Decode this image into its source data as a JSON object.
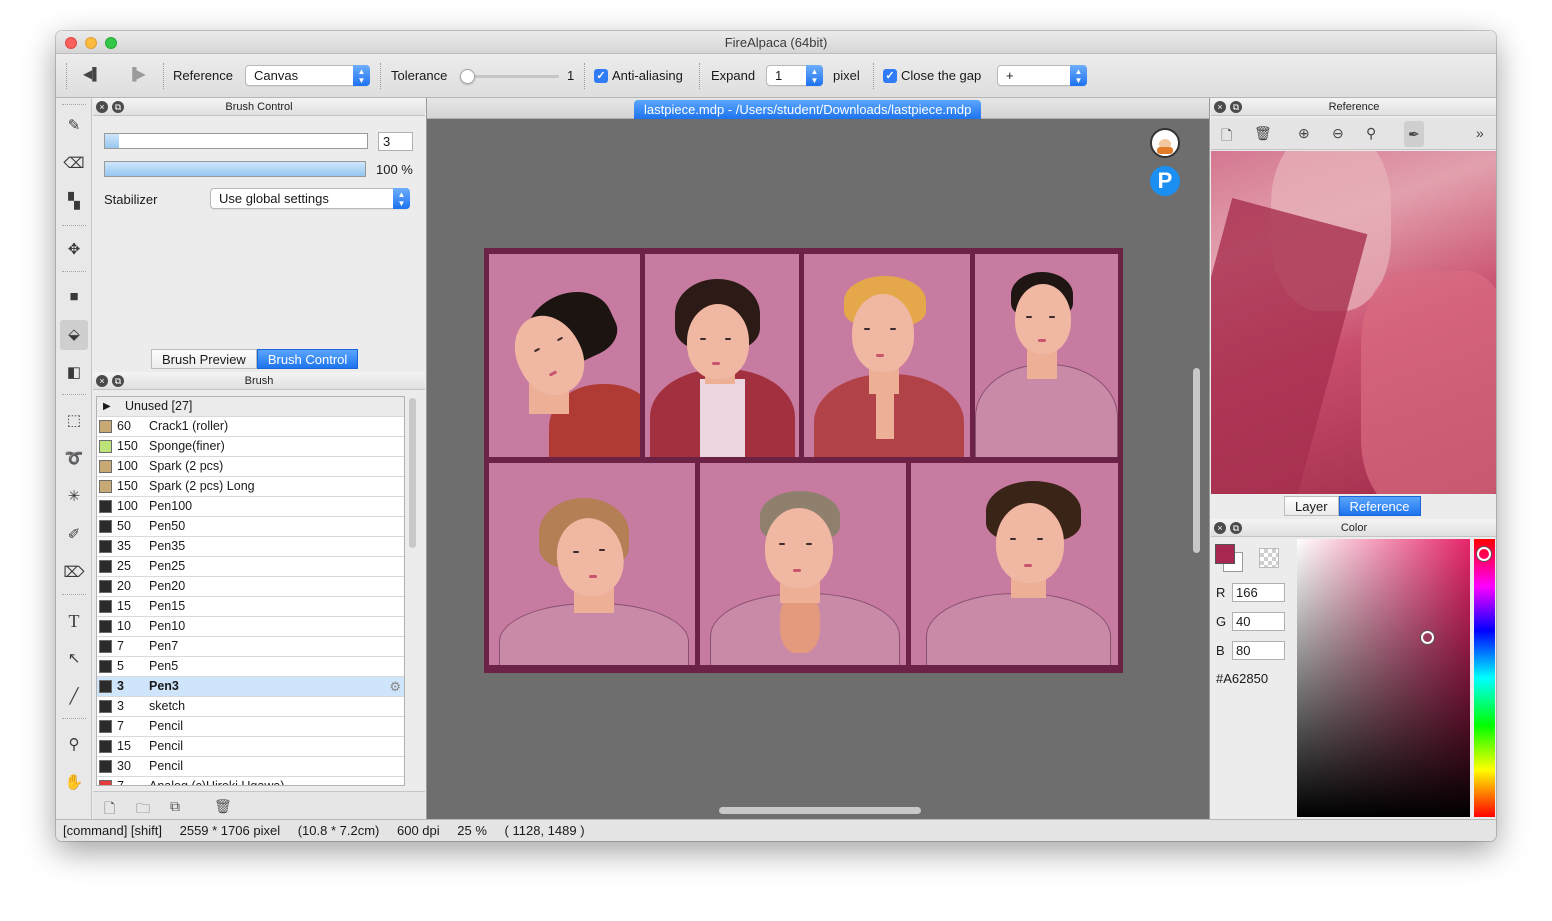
{
  "window": {
    "title": "FireAlpaca (64bit)"
  },
  "toolbar": {
    "reference_label": "Reference",
    "reference_value": "Canvas",
    "tolerance_label": "Tolerance",
    "tolerance_value": "1",
    "tolerance_level": 0.0,
    "antialiasing_label": "Anti-aliasing",
    "antialiasing_checked": true,
    "expand_label": "Expand",
    "expand_value": "1",
    "pixel_label": "pixel",
    "close_gap_label": "Close the gap",
    "close_gap_checked": true,
    "close_gap_value": "+"
  },
  "tools": [
    "pen-icon",
    "eraser-icon",
    "dot-icon",
    "move-icon",
    "fill-rect-icon",
    "bucket-icon",
    "gradient-icon",
    "select-rect-icon",
    "lasso-icon",
    "magic-wand-icon",
    "select-pen-icon",
    "select-eraser-icon",
    "text-icon",
    "operation-icon",
    "divide-icon",
    "eyedropper-icon",
    "hand-icon"
  ],
  "brush_control": {
    "title": "Brush Control",
    "size_value": "3",
    "size_level": 0.02,
    "opacity_value": "100 %",
    "opacity_level": 1.0,
    "stabilizer_label": "Stabilizer",
    "stabilizer_value": "Use global settings",
    "tabs": [
      {
        "label": "Brush Preview"
      },
      {
        "label": "Brush Control",
        "active": true
      }
    ]
  },
  "brush": {
    "title": "Brush",
    "group_label": "Unused [27]",
    "items": [
      {
        "size": "60",
        "name": "Crack1 (roller)",
        "color": "#c8a873"
      },
      {
        "size": "150",
        "name": "Sponge(finer)",
        "color": "#bde27a"
      },
      {
        "size": "100",
        "name": "Spark (2 pcs)",
        "color": "#c8a873"
      },
      {
        "size": "150",
        "name": "Spark (2 pcs) Long",
        "color": "#c8a873"
      },
      {
        "size": "100",
        "name": "Pen100",
        "color": "#2b2b2b"
      },
      {
        "size": "50",
        "name": "Pen50",
        "color": "#2b2b2b"
      },
      {
        "size": "35",
        "name": "Pen35",
        "color": "#2b2b2b"
      },
      {
        "size": "25",
        "name": "Pen25",
        "color": "#2b2b2b"
      },
      {
        "size": "20",
        "name": "Pen20",
        "color": "#2b2b2b"
      },
      {
        "size": "15",
        "name": "Pen15",
        "color": "#2b2b2b"
      },
      {
        "size": "10",
        "name": "Pen10",
        "color": "#2b2b2b"
      },
      {
        "size": "7",
        "name": "Pen7",
        "color": "#2b2b2b"
      },
      {
        "size": "5",
        "name": "Pen5",
        "color": "#2b2b2b"
      },
      {
        "size": "3",
        "name": "Pen3",
        "color": "#2b2b2b",
        "selected": true
      },
      {
        "size": "3",
        "name": "sketch",
        "color": "#2b2b2b"
      },
      {
        "size": "7",
        "name": "Pencil",
        "color": "#2b2b2b"
      },
      {
        "size": "15",
        "name": "Pencil",
        "color": "#2b2b2b"
      },
      {
        "size": "30",
        "name": "Pencil",
        "color": "#2b2b2b"
      },
      {
        "size": "7",
        "name": "Analog (c)Hiroki Ugawa)",
        "color": "#e53b3b"
      }
    ],
    "bottom_icons": [
      "new-brush-icon",
      "folder-icon",
      "duplicate-icon",
      "trash-icon"
    ]
  },
  "document": {
    "tab_label": "lastpiece.mdp - /Users/student/Downloads/lastpiece.mdp"
  },
  "reference": {
    "title": "Reference",
    "toolbar_icons": [
      "new-icon",
      "trash-icon",
      "zoom-in-icon",
      "zoom-out-icon",
      "zoom-fit-icon",
      "eyedropper-icon",
      "expand-icon"
    ],
    "tabs": [
      {
        "label": "Layer"
      },
      {
        "label": "Reference",
        "active": true
      }
    ]
  },
  "color": {
    "title": "Color",
    "r_label": "R",
    "r_value": "166",
    "g_label": "G",
    "g_value": "40",
    "b_label": "B",
    "b_value": "80",
    "hex": "#A62850",
    "primary": "#a62850"
  },
  "status": {
    "modifiers": "[command] [shift]",
    "size": "2559 * 1706 pixel",
    "physical": "(10.8 * 7.2cm)",
    "dpi": "600 dpi",
    "zoom": "25 %",
    "cursor": "( 1128, 1489 )"
  }
}
